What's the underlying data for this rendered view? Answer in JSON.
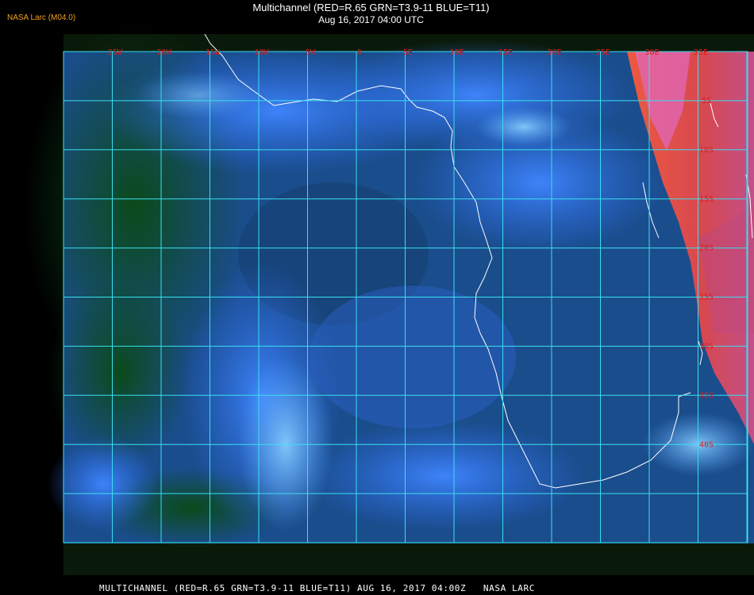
{
  "header": {
    "credit": "NASA Larc (M04.0)",
    "title": "Multichannel (RED=R.65 GRN=T3.9-11 BLUE=T11)",
    "datetime": "Aug 16, 2017 04:00 UTC"
  },
  "map": {
    "longitude_labels": [
      "25W",
      "20W",
      "15W",
      "10W",
      "5W",
      "0",
      "5E",
      "10E",
      "15E",
      "20E",
      "25E",
      "30E",
      "35E"
    ],
    "latitude_labels": [
      "5S",
      "10S",
      "15S",
      "20S",
      "25S",
      "30S",
      "35S",
      "40S"
    ],
    "colors": {
      "grid": "#38e0f0",
      "grid_label": "#e21b1b",
      "coastline": "#ffffff",
      "ocean_dark": "#0b3a12",
      "cloud_blue": "#2f6ef0",
      "cloud_light": "#80c8ff",
      "land_hot": "#e04a4a"
    }
  },
  "footer": {
    "text": "MULTICHANNEL (RED=R.65 GRN=T3.9-11 BLUE=T11) AUG 16, 2017 04:00Z   NASA LARC"
  }
}
